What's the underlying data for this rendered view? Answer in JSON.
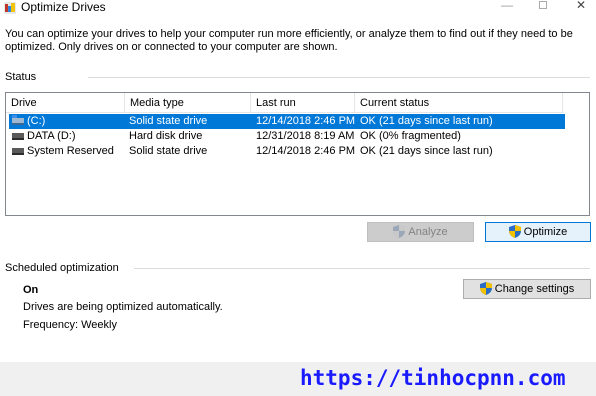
{
  "window": {
    "title": "Optimize Drives",
    "controls": {
      "minimize": "—",
      "close": "✕"
    }
  },
  "intro": "You can optimize your drives to help your computer run more efficiently, or analyze them to find out if they need to be optimized. Only drives on or connected to your computer are shown.",
  "status": {
    "label": "Status",
    "columns": [
      "Drive",
      "Media type",
      "Last run",
      "Current status"
    ],
    "rows": [
      {
        "icon": "os-drive-icon",
        "drive": "(C:)",
        "media": "Solid state drive",
        "last_run": "12/14/2018 2:46 PM",
        "status": "OK (21 days since last run)",
        "selected": true
      },
      {
        "icon": "hard-drive-icon",
        "drive": "DATA (D:)",
        "media": "Hard disk drive",
        "last_run": "12/31/2018 8:19 AM",
        "status": "OK (0% fragmented)",
        "selected": false
      },
      {
        "icon": "hard-drive-icon",
        "drive": "System Reserved",
        "media": "Solid state drive",
        "last_run": "12/14/2018 2:46 PM",
        "status": "OK (21 days since last run)",
        "selected": false
      }
    ]
  },
  "buttons": {
    "analyze": "Analyze",
    "optimize": "Optimize",
    "change_settings": "Change settings"
  },
  "scheduled": {
    "label": "Scheduled optimization",
    "state": "On",
    "description": "Drives are being optimized automatically.",
    "frequency": "Frequency: Weekly"
  },
  "watermark": "https://tinhocpnn.com",
  "colors": {
    "selection": "#0078d7",
    "watermark": "#1a1aff",
    "shield_blue": "#2b6cc4",
    "shield_yellow": "#f2c200"
  }
}
